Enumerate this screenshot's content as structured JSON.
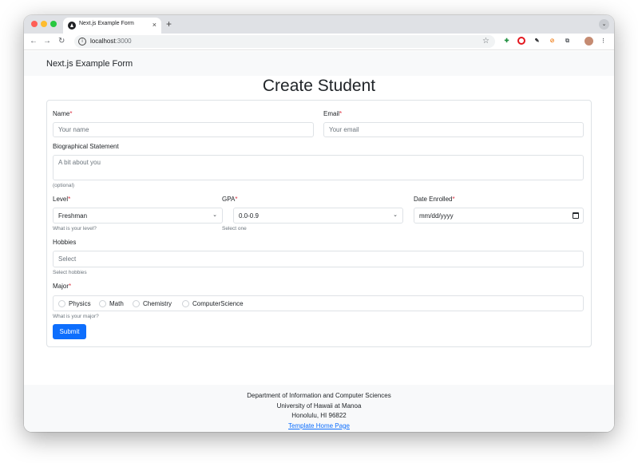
{
  "browser": {
    "tab_title": "Next.js Example Form",
    "tab_close": "×",
    "new_tab": "+",
    "url_host": "localhost",
    "url_port": ":3000",
    "extension_icons": [
      "green-puzzle-icon",
      "opera-icon",
      "pen-icon",
      "block-icon",
      "extensions-icon",
      "profile-avatar"
    ],
    "colors": {
      "tab_bar": "#dfe1e5",
      "omnibox": "#f1f3f4"
    }
  },
  "navbar": {
    "brand": "Next.js Example Form"
  },
  "page": {
    "heading": "Create Student"
  },
  "form": {
    "name": {
      "label": "Name",
      "required_mark": "*",
      "placeholder": "Your name"
    },
    "email": {
      "label": "Email",
      "required_mark": "*",
      "placeholder": "Your email"
    },
    "bio": {
      "label": "Biographical Statement",
      "placeholder": "A bit about you",
      "help": "(optional)"
    },
    "level": {
      "label": "Level",
      "required_mark": "*",
      "value": "Freshman",
      "help": "What is your level?"
    },
    "gpa": {
      "label": "GPA",
      "required_mark": "*",
      "value": "0.0-0.9",
      "help": "Select one"
    },
    "date_enrolled": {
      "label": "Date Enrolled",
      "required_mark": "*",
      "placeholder": "mm/dd/yyyy"
    },
    "hobbies": {
      "label": "Hobbies",
      "placeholder": "Select",
      "help": "Select hobbies"
    },
    "major": {
      "label": "Major",
      "required_mark": "*",
      "options": [
        "Physics",
        "Math",
        "Chemistry",
        "ComputerScience"
      ],
      "help": "What is your major?"
    },
    "submit_label": "Submit",
    "colors": {
      "primary": "#0d6efd",
      "required": "#dc3545",
      "muted": "#6c757d",
      "border": "#dee2e6"
    }
  },
  "footer": {
    "line1": "Department of Information and Computer Sciences",
    "line2": "University of Hawaii at Manoa",
    "line3": "Honolulu, HI 96822",
    "link": "Template Home Page"
  }
}
